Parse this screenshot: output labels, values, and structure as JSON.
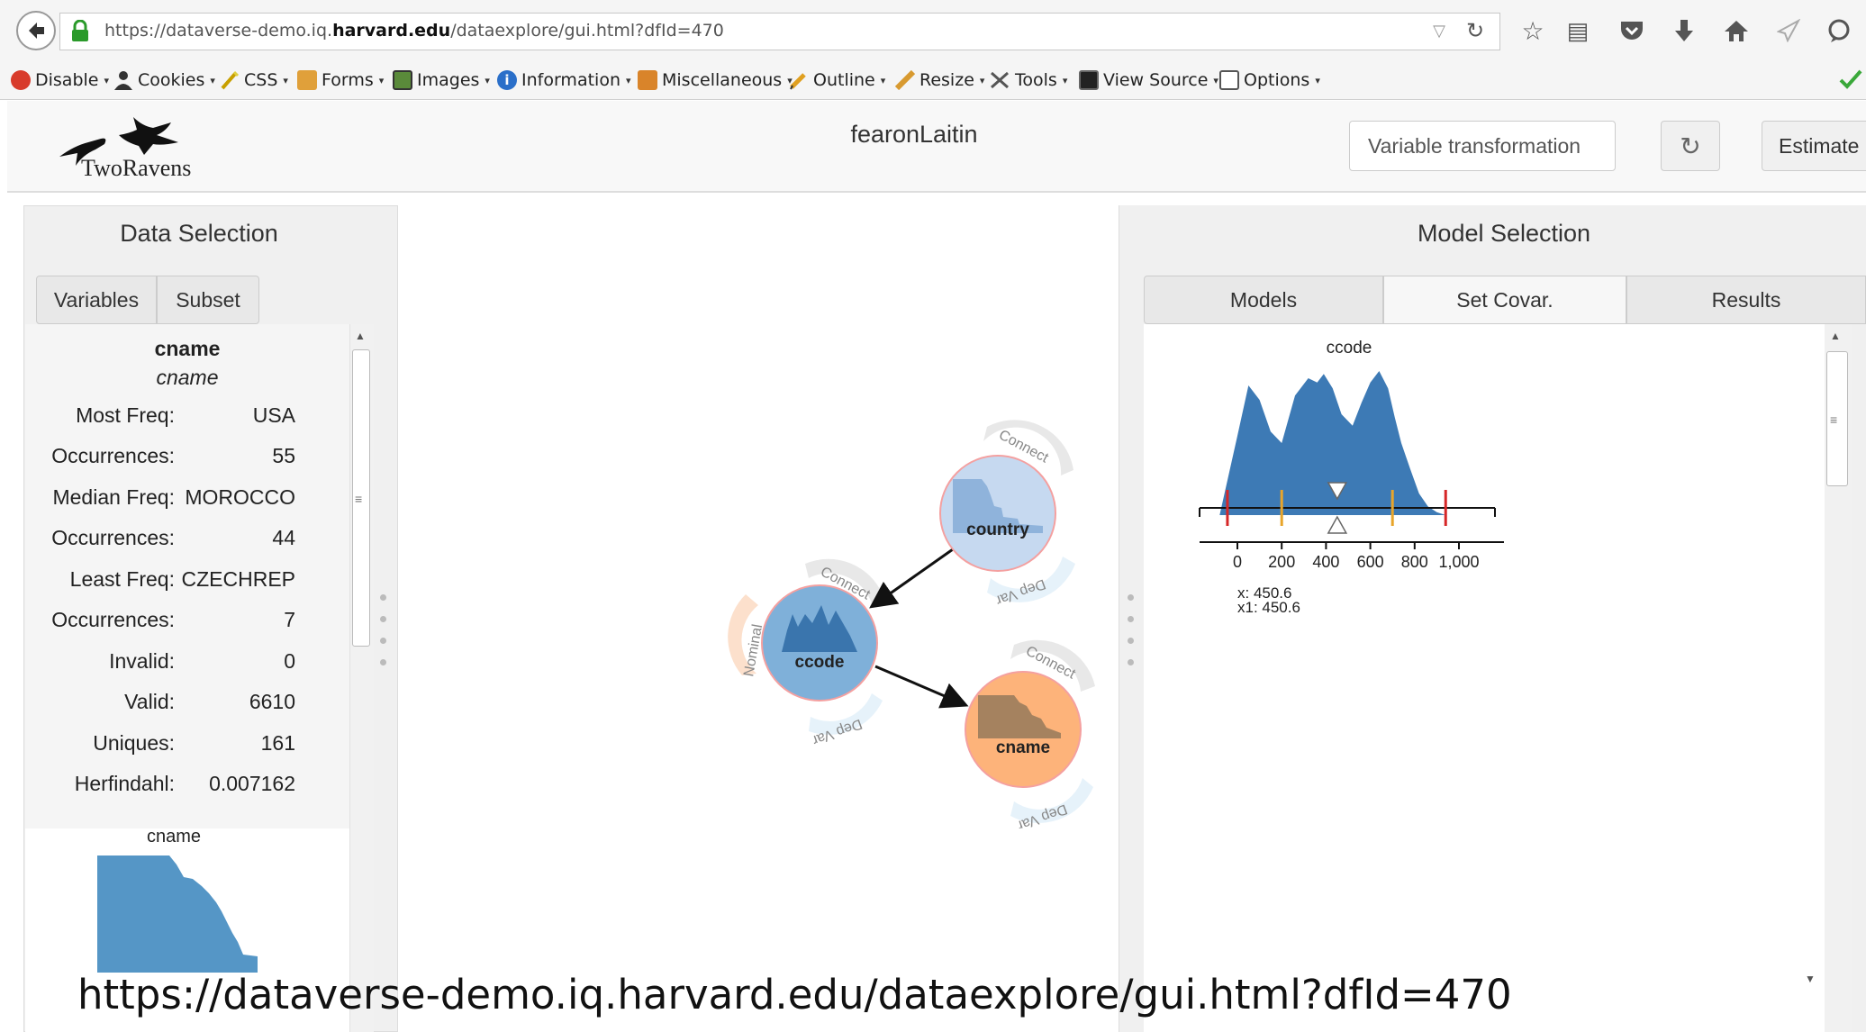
{
  "browser": {
    "url_prefix": "https://dataverse-demo.iq.",
    "url_domain": "harvard.edu",
    "url_suffix": "/dataexplore/gui.html?dfId=470"
  },
  "toolbar": {
    "items": [
      {
        "label": "Disable",
        "icon": "no-entry-icon"
      },
      {
        "label": "Cookies",
        "icon": "person-icon"
      },
      {
        "label": "CSS",
        "icon": "wand-icon"
      },
      {
        "label": "Forms",
        "icon": "clipboard-icon"
      },
      {
        "label": "Images",
        "icon": "image-icon"
      },
      {
        "label": "Information",
        "icon": "info-icon"
      },
      {
        "label": "Miscellaneous",
        "icon": "notebook-icon"
      },
      {
        "label": "Outline",
        "icon": "pencil-icon"
      },
      {
        "label": "Resize",
        "icon": "ruler-icon"
      },
      {
        "label": "Tools",
        "icon": "tools-icon"
      },
      {
        "label": "View Source",
        "icon": "terminal-icon"
      },
      {
        "label": "Options",
        "icon": "options-icon"
      }
    ]
  },
  "header": {
    "logo_text": "TwoRavens",
    "dataset_title": "fearonLaitin",
    "transform_placeholder": "Variable transformation",
    "estimate_label": "Estimate"
  },
  "left_panel": {
    "title": "Data Selection",
    "tabs": [
      "Variables",
      "Subset"
    ],
    "var_name": "cname",
    "var_label": "cname",
    "stats": [
      {
        "key": "Most Freq:",
        "value": "USA"
      },
      {
        "key": "Occurrences:",
        "value": "55"
      },
      {
        "key": "Median Freq:",
        "value": "MOROCCO"
      },
      {
        "key": "Occurrences:",
        "value": "44"
      },
      {
        "key": "Least Freq:",
        "value": "CZECHREP"
      },
      {
        "key": "Occurrences:",
        "value": "7"
      },
      {
        "key": "Invalid:",
        "value": "0"
      },
      {
        "key": "Valid:",
        "value": "6610"
      },
      {
        "key": "Uniques:",
        "value": "161"
      },
      {
        "key": "Herfindahl:",
        "value": "0.007162"
      }
    ],
    "plot_title": "cname"
  },
  "graph": {
    "nodes": [
      {
        "id": "country",
        "label": "country",
        "fill": "#c6d9f0",
        "shape_fill": "#8fb3db"
      },
      {
        "id": "ccode",
        "label": "ccode",
        "fill": "#7fb0d9",
        "shape_fill": "#3a75ad"
      },
      {
        "id": "cname",
        "label": "cname",
        "fill": "#fdb37a",
        "shape_fill": "#a5825f"
      }
    ],
    "arc_labels": {
      "connect": "Connect",
      "dep_var": "Dep Var",
      "nominal": "Nominal"
    }
  },
  "right_panel": {
    "title": "Model Selection",
    "tabs": [
      "Models",
      "Set Covar.",
      "Results"
    ],
    "active_tab": "Set Covar.",
    "plot_title": "ccode",
    "axis_ticks": [
      "0",
      "200",
      "400",
      "600",
      "800",
      "1,000"
    ],
    "readout_x": "x: 450.6",
    "readout_x1": "x1: 450.6"
  },
  "chart_data": {
    "type": "area",
    "title": "ccode",
    "xlabel": "",
    "ylabel": "",
    "xlim": [
      -120,
      1070
    ],
    "x": [
      -80,
      0,
      50,
      100,
      150,
      200,
      260,
      320,
      360,
      390,
      430,
      470,
      520,
      560,
      600,
      640,
      680,
      710,
      740,
      780,
      820,
      860,
      900,
      940,
      1000,
      1050
    ],
    "values": [
      0,
      0.55,
      0.9,
      0.8,
      0.58,
      0.5,
      0.83,
      0.95,
      0.92,
      0.98,
      0.88,
      0.7,
      0.62,
      0.78,
      0.92,
      1.0,
      0.88,
      0.68,
      0.5,
      0.32,
      0.15,
      0.06,
      0.02,
      0.0,
      0.0,
      0.0
    ],
    "markers": {
      "red": [
        -45,
        940
      ],
      "orange": [
        200,
        700
      ],
      "selected": 450.6
    }
  },
  "colors": {
    "density": "#3d7ab5",
    "red_mark": "#d62728",
    "orange_mark": "#e8a52a",
    "left_hist": "#5596c6"
  },
  "caption": "https://dataverse-demo.iq.harvard.edu/dataexplore/gui.html?dfId=470"
}
